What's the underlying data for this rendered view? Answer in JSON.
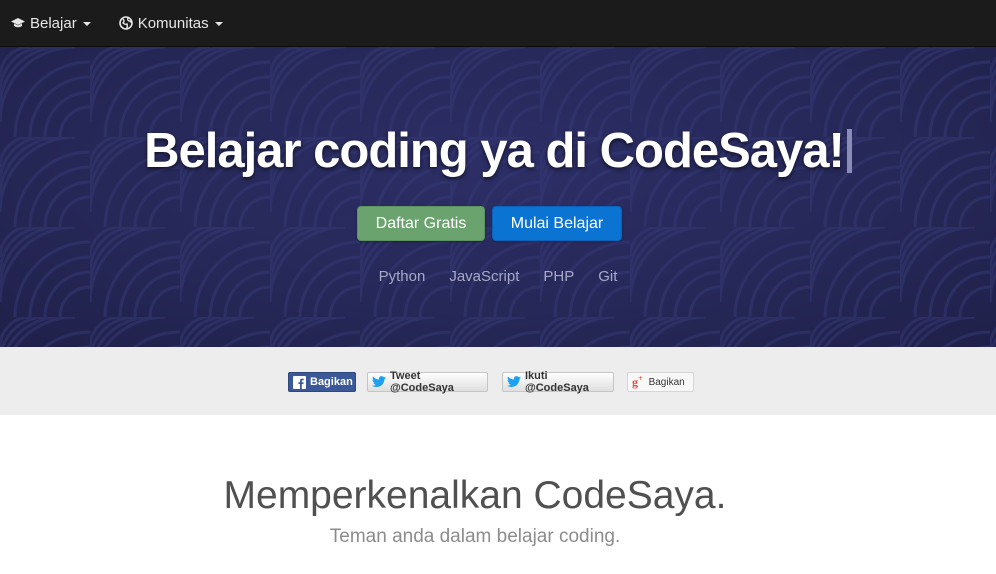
{
  "navbar": {
    "items": [
      {
        "label": "Belajar",
        "icon": "graduation-cap-icon"
      },
      {
        "label": "Komunitas",
        "icon": "globe-icon"
      }
    ]
  },
  "hero": {
    "title": "Belajar coding ya di CodeSaya!",
    "signup_button": "Daftar Gratis",
    "start_button": "Mulai Belajar",
    "languages": [
      "Python",
      "JavaScript",
      "PHP",
      "Git"
    ]
  },
  "share": {
    "facebook": "Bagikan",
    "tweet": "Tweet @CodeSaya",
    "follow": "Ikuti @CodeSaya",
    "googleplus": "Bagikan"
  },
  "intro": {
    "title": "Memperkenalkan CodeSaya.",
    "subtitle": "Teman anda dalam belajar coding."
  },
  "colors": {
    "navbar_bg": "#1b1b1b",
    "hero_bg": "#262858",
    "signup_green": "#6aa36e",
    "start_blue": "#0b73d2",
    "facebook_blue": "#3b5998",
    "twitter_blue": "#1da1f2",
    "share_bar_bg": "#ededed"
  }
}
